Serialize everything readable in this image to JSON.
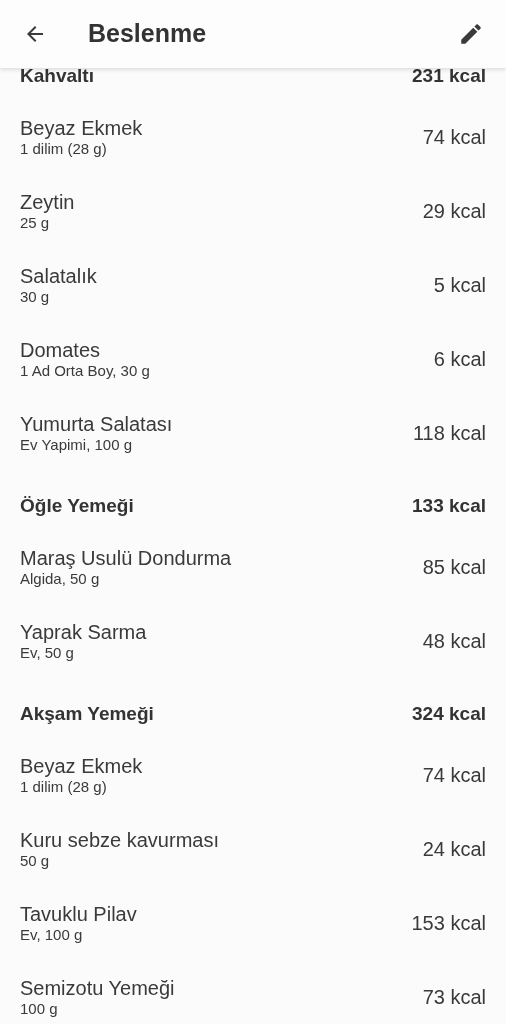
{
  "app_bar": {
    "title": "Beslenme"
  },
  "meals": [
    {
      "name": "Kahvaltı",
      "total": "231 kcal",
      "items": [
        {
          "name": "Beyaz Ekmek",
          "detail": "1 dilim (28 g)",
          "kcal": "74 kcal"
        },
        {
          "name": "Zeytin",
          "detail": "25 g",
          "kcal": "29 kcal"
        },
        {
          "name": "Salatalık",
          "detail": "30 g",
          "kcal": "5 kcal"
        },
        {
          "name": "Domates",
          "detail": "1 Ad Orta Boy, 30 g",
          "kcal": "6 kcal"
        },
        {
          "name": "Yumurta Salatası",
          "detail": "Ev Yapimi, 100 g",
          "kcal": "118 kcal"
        }
      ]
    },
    {
      "name": "Öğle Yemeği",
      "total": "133 kcal",
      "items": [
        {
          "name": "Maraş Usulü Dondurma",
          "detail": "Algida, 50 g",
          "kcal": "85 kcal"
        },
        {
          "name": "Yaprak Sarma",
          "detail": "Ev, 50 g",
          "kcal": "48 kcal"
        }
      ]
    },
    {
      "name": "Akşam Yemeği",
      "total": "324 kcal",
      "items": [
        {
          "name": "Beyaz Ekmek",
          "detail": "1 dilim (28 g)",
          "kcal": "74 kcal"
        },
        {
          "name": "Kuru sebze kavurması",
          "detail": "50 g",
          "kcal": "24 kcal"
        },
        {
          "name": "Tavuklu Pilav",
          "detail": "Ev, 100 g",
          "kcal": "153 kcal"
        },
        {
          "name": "Semizotu Yemeği",
          "detail": "100 g",
          "kcal": "73 kcal"
        }
      ]
    }
  ]
}
